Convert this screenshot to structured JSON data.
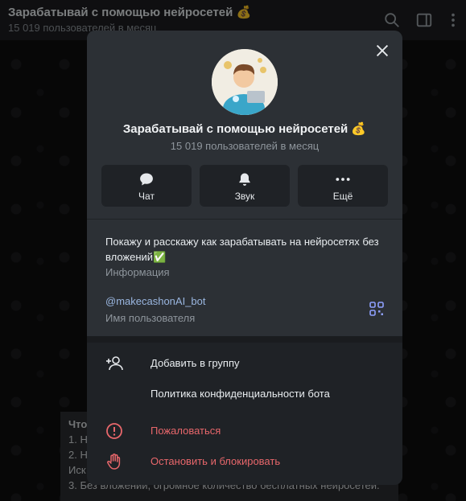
{
  "header": {
    "title": "Зарабатывай с помощью нейросетей 💰",
    "subtitle": "15 019 пользователей в месяц",
    "icons": [
      "search-icon",
      "sidebar-toggle-icon",
      "more-icon"
    ]
  },
  "background_message": {
    "title": "Что",
    "lines": [
      "1. Н",
      "2. Н",
      "Иск",
      "3. Без вложений, огромное количество бесплатных нейросетей."
    ]
  },
  "profile": {
    "name": "Зарабатывай с помощью нейросетей 💰",
    "subtitle": "15 019 пользователей в месяц",
    "actions": [
      {
        "label": "Чат",
        "icon": "chat-icon"
      },
      {
        "label": "Звук",
        "icon": "bell-icon"
      },
      {
        "label": "Ещё",
        "icon": "more-icon"
      }
    ],
    "about": "Покажу и расскажу как зарабатывать на нейросетях без вложений✅",
    "about_label": "Информация",
    "username": "@makecashonAI_bot",
    "username_label": "Имя пользователя",
    "menu": [
      {
        "label": "Добавить в группу",
        "icon": "add-user-icon"
      },
      {
        "label": "Политика конфиденциальности бота",
        "icon": ""
      },
      {
        "label": "Пожаловаться",
        "icon": "report-icon"
      },
      {
        "label": "Остановить и блокировать",
        "icon": "block-hand-icon"
      }
    ]
  },
  "colors": {
    "panel": "#2c3035",
    "panel_dark": "#1f2226",
    "link": "#9ab6e0",
    "danger": "#e8676b",
    "qr": "#8fa0ff"
  }
}
